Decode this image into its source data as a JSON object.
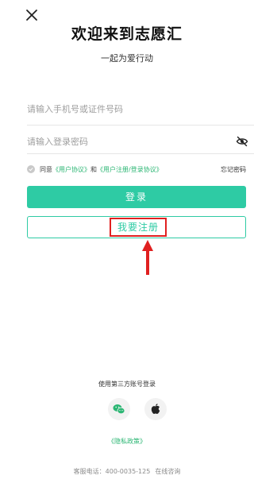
{
  "header": {
    "title": "欢迎来到志愿汇",
    "subtitle": "一起为爱行动"
  },
  "form": {
    "phone_placeholder": "请输入手机号或证件号码",
    "password_placeholder": "请输入登录密码"
  },
  "agreement": {
    "agree": "同意",
    "user_agreement": "《用户协议》",
    "and": "和",
    "register_login_agreement": "《用户注册/登录协议》",
    "checked": false
  },
  "forgot_password": "忘记密码",
  "login_label": "登录",
  "register_label": "我要注册",
  "third_party": {
    "label": "使用第三方账号登录",
    "providers": [
      "wechat",
      "apple"
    ]
  },
  "privacy_link": "《隐私政策》",
  "footer": {
    "service_phone": "客服电话：400-0035-125",
    "online_consult": "在线咨询"
  },
  "colors": {
    "primary": "#2ecba4",
    "link": "#2bb673",
    "highlight_box": "#e02020"
  },
  "icons": {
    "close": "close-icon",
    "password_toggle": "eye-hidden-icon",
    "wechat": "wechat-icon",
    "apple": "apple-icon"
  }
}
